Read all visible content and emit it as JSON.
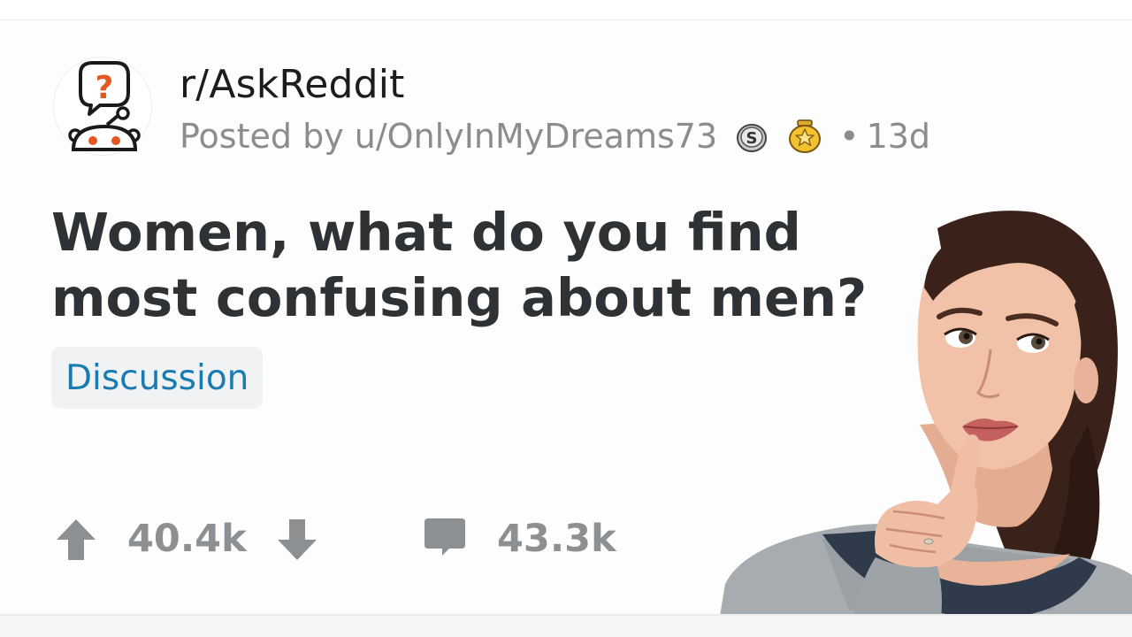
{
  "post": {
    "subreddit": "r/AskReddit",
    "posted_by": "Posted by u/OnlyInMyDreams73",
    "time_separator": "•",
    "age": "13d",
    "title": "Women, what do you find most confusing about men?",
    "flair": "Discussion",
    "upvotes": "40.4k",
    "comments": "43.3k"
  },
  "icons": {
    "subreddit_avatar": "askreddit-snoo-question-icon",
    "award_1": "silver-award-icon",
    "award_2": "gold-award-icon",
    "upvote": "upvote-arrow-icon",
    "downvote": "downvote-arrow-icon",
    "comments": "comment-bubble-icon"
  },
  "colors": {
    "text_primary": "#1c1c1c",
    "text_secondary": "#8a8c8e",
    "flair_text": "#1a7bb3",
    "flair_bg": "#f0f2f4",
    "accent_orange": "#e4571f"
  }
}
